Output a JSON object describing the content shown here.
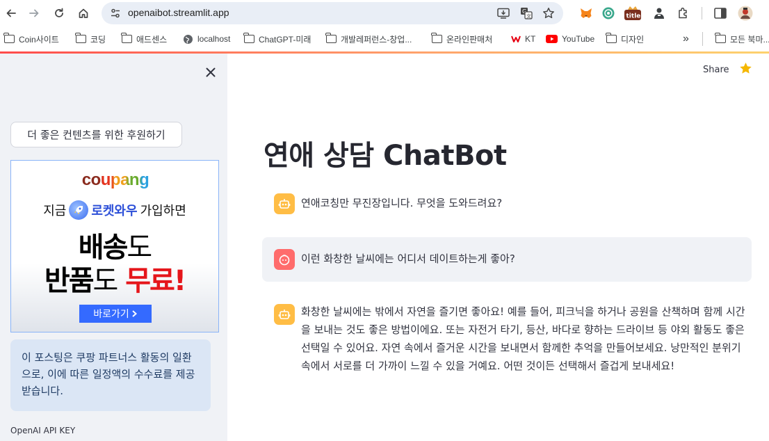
{
  "browser": {
    "url": "openaibot.streamlit.app",
    "bookmarks": [
      {
        "label": "Coin사이트",
        "icon": "folder-icon"
      },
      {
        "label": "코딩",
        "icon": "folder-icon"
      },
      {
        "label": "애드센스",
        "icon": "folder-icon"
      },
      {
        "label": "localhost",
        "icon": "globe-icon"
      },
      {
        "label": "ChatGPT-미래",
        "icon": "folder-icon"
      },
      {
        "label": "개발레퍼런스-창업...",
        "icon": "folder-icon"
      },
      {
        "label": "온라인판매처",
        "icon": "folder-icon"
      },
      {
        "label": "KT",
        "icon": "kt-logo-icon"
      },
      {
        "label": "YouTube",
        "icon": "youtube-icon"
      },
      {
        "label": "디자인",
        "icon": "folder-icon"
      }
    ],
    "overflow": "»",
    "all_bookmarks": "모든 북마..."
  },
  "sidebar": {
    "donate_button": "더 좋은 컨텐츠를 위한 후원하기",
    "ad": {
      "logo": "coupang",
      "line1_prefix": "지금",
      "line1_brand": "로켓와우",
      "line1_suffix": "가입하면",
      "line2_bold": "배송",
      "line2_thin": "도",
      "line3_bold": "반품",
      "line3_thin": "도",
      "line3_red": "무료!",
      "cta": "바로가기"
    },
    "disclosure": "이 포스팅은 쿠팡 파트너스 활동의 일환으로, 이에 따른 일정액의 수수료를 제공받습니다.",
    "api_label": "OpenAI API KEY"
  },
  "main": {
    "share": "Share",
    "title": "연애 상담 ChatBot",
    "messages": [
      {
        "role": "assistant",
        "text": "연애코칭만 무진장입니다. 무엇을 도와드려요?"
      },
      {
        "role": "user",
        "text": "이런 화창한 날씨에는 어디서 데이트하는게 좋아?"
      },
      {
        "role": "assistant",
        "text": "화창한 날씨에는 밖에서 자연을 즐기면 좋아요! 예를 들어, 피크닉을 하거나 공원을 산책하며 함께 시간을 보내는 것도 좋은 방법이에요. 또는 자전거 타기, 등산, 바다로 향하는 드라이브 등 야외 활동도 좋은 선택일 수 있어요. 자연 속에서 즐거운 시간을 보내면서 함께한 추억을 만들어보세요. 낭만적인 분위기 속에서 서로를 더 가까이 느낄 수 있을 거예요. 어떤 것이든 선택해서 즐겁게 보내세요!"
      }
    ]
  },
  "colors": {
    "accent_start": "#ff4b4b",
    "accent_end": "#fdd26e",
    "sidebar_bg": "#f0f2f6",
    "bot_avatar": "#ffbd45",
    "user_avatar": "#ff6c6c",
    "info_bg": "#dbe6f5"
  }
}
